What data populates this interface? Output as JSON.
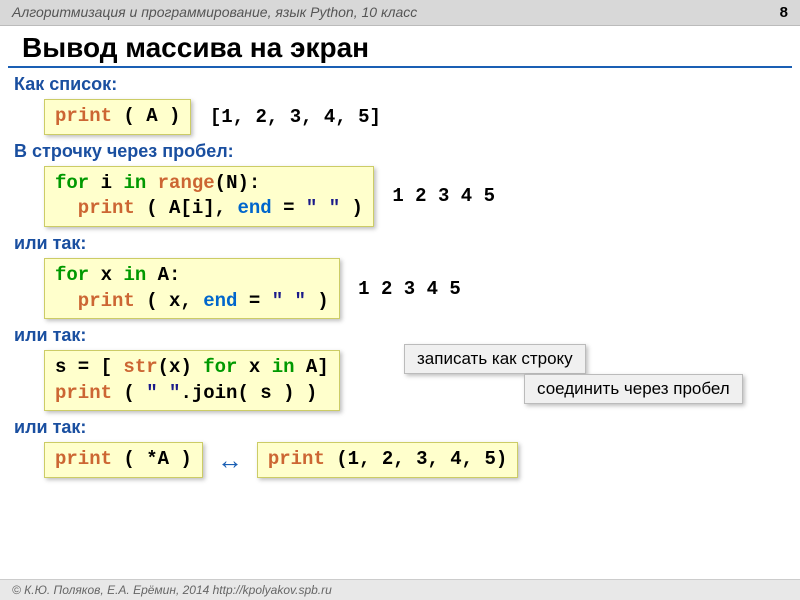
{
  "header": {
    "breadcrumb": "Алгоритмизация и программирование, язык Python, 10 класс",
    "page": "8"
  },
  "title": "Вывод массива на экран",
  "labels": {
    "as_list": "Как список:",
    "as_line": "В строчку через пробел:",
    "or1": "или так:",
    "or2": "или так:",
    "or3": "или так:"
  },
  "code": {
    "c1_print": "print",
    "c1_rest": " ( A )",
    "out1": "[1, 2, 3, 4, 5]",
    "c2_for": "for",
    "c2_mid": " i ",
    "c2_in": "in",
    "c2_range": " range",
    "c2_tail": "(N):",
    "c2_print": "  print",
    "c2_args": " ( A[i], ",
    "c2_end": "end",
    "c2_eq": " = ",
    "c2_sp": "\" \"",
    "c2_close": " )",
    "out2": "1 2 3 4 5",
    "c3_for": "for",
    "c3_mid": " x ",
    "c3_in": "in",
    "c3_tail": " A:",
    "c3_print": "  print",
    "c3_args": " ( x, ",
    "c3_end": "end",
    "c3_eq": " = ",
    "c3_sp": "\" \"",
    "c3_close": " )",
    "out3": "1 2 3 4 5",
    "c4_s": "s = [ ",
    "c4_str": "str",
    "c4_x": "(x) ",
    "c4_for": "for",
    "c4_mid": " x ",
    "c4_in": "in",
    "c4_tail": " A]",
    "c4_print": "print",
    "c4_args": " ( ",
    "c4_sp": "\" \"",
    "c4_join": ".join( s ) )",
    "c5_print": "print",
    "c5_rest": " ( *A )",
    "c6_print": "print",
    "c6_rest": " (1, 2, 3, 4, 5)"
  },
  "callouts": {
    "as_string": "записать как строку",
    "join_space": "соединить через пробел"
  },
  "footer": "© К.Ю. Поляков, Е.А. Ерёмин, 2014   http://kpolyakov.spb.ru"
}
